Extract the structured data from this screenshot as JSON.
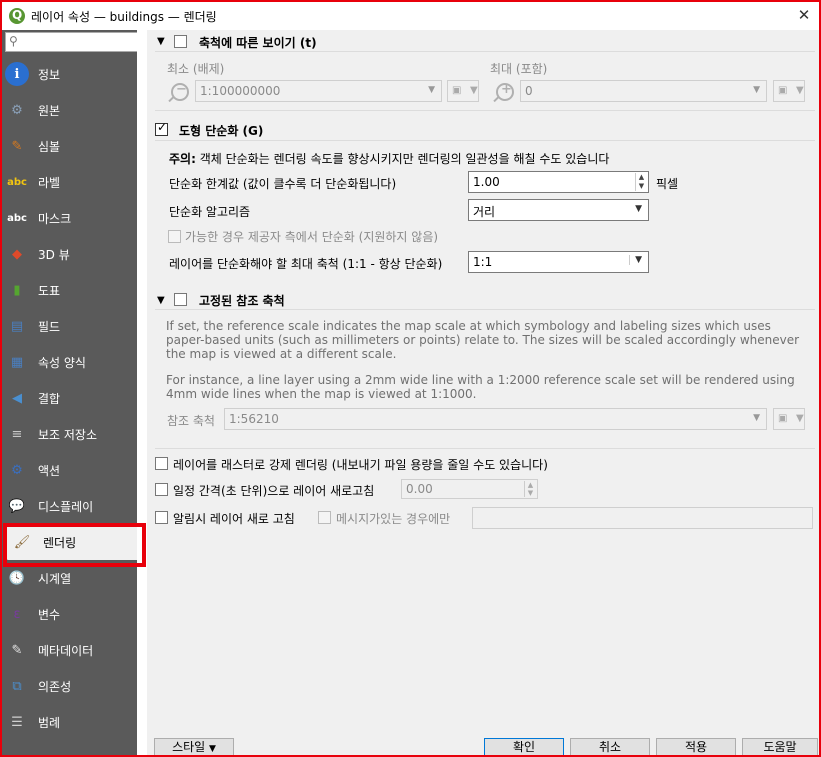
{
  "window": {
    "title": "레이어 속성 — buildings — 렌더링",
    "close_glyph": "✕"
  },
  "sidebar": {
    "search_placeholder": "",
    "items": [
      {
        "label": "정보",
        "icon": "info-icon",
        "color": "#2a6fd0",
        "glyph": "i"
      },
      {
        "label": "원본",
        "icon": "source-icon",
        "color": "#8aa0b8",
        "glyph": "⚙"
      },
      {
        "label": "심볼",
        "icon": "symbology-icon",
        "color": "#d87a1e",
        "glyph": "✎"
      },
      {
        "label": "라벨",
        "icon": "labels-icon",
        "color": "#f2c511",
        "glyph": "abc"
      },
      {
        "label": "마스크",
        "icon": "mask-icon",
        "color": "#ffffff",
        "glyph": "abc"
      },
      {
        "label": "3D 뷰",
        "icon": "3d-view-icon",
        "color": "#e04a2a",
        "glyph": "◆"
      },
      {
        "label": "도표",
        "icon": "diagrams-icon",
        "color": "#55a630",
        "glyph": "▮"
      },
      {
        "label": "필드",
        "icon": "fields-icon",
        "color": "#4a7fc0",
        "glyph": "▤"
      },
      {
        "label": "속성 양식",
        "icon": "attributes-form-icon",
        "color": "#4a7fc0",
        "glyph": "▦"
      },
      {
        "label": "결합",
        "icon": "joins-icon",
        "color": "#4a8fd0",
        "glyph": "◀"
      },
      {
        "label": "보조 저장소",
        "icon": "auxiliary-storage-icon",
        "color": "#c8c8c8",
        "glyph": "≡"
      },
      {
        "label": "액션",
        "icon": "actions-icon",
        "color": "#3a6fc0",
        "glyph": "⚙"
      },
      {
        "label": "디스플레이",
        "icon": "display-icon",
        "color": "#f4d44a",
        "glyph": "💬"
      },
      {
        "label": "렌더링",
        "icon": "rendering-icon",
        "color": "#8a6a3a",
        "glyph": "🖌",
        "active": true
      },
      {
        "label": "시계열",
        "icon": "temporal-icon",
        "color": "#ffffff",
        "glyph": "🕓"
      },
      {
        "label": "변수",
        "icon": "variables-icon",
        "color": "#7a3aa0",
        "glyph": "ε"
      },
      {
        "label": "메타데이터",
        "icon": "metadata-icon",
        "color": "#e0e0e0",
        "glyph": "✎"
      },
      {
        "label": "의존성",
        "icon": "dependencies-icon",
        "color": "#4a8fd0",
        "glyph": "⧉"
      },
      {
        "label": "범례",
        "icon": "legend-icon",
        "color": "#d0d0d0",
        "glyph": "☰"
      }
    ]
  },
  "scale_visibility": {
    "label": "축척에 따른 보이기 (t)",
    "min_label": "최소 (배제)",
    "min_value": "1:100000000",
    "max_label": "최대 (포함)",
    "max_value": "0"
  },
  "simplify": {
    "label": "도형 단순화 (G)",
    "note_prefix": "주의:",
    "note": " 객체 단순화는 렌더링 속도를 향상시키지만 렌더링의 일관성을 해칠 수도 있습니다",
    "threshold_label": "단순화 한계값 (값이 클수록 더 단순화됩니다)",
    "threshold_value": "1.00",
    "threshold_unit": "픽셀",
    "algorithm_label": "단순화 알고리즘",
    "algorithm_value": "거리",
    "provider_label": "가능한 경우 제공자 측에서 단순화 (지원하지 않음)",
    "max_scale_label": "레이어를 단순화해야 할 최대 축척 (1:1 - 항상 단순화)",
    "max_scale_value": "1:1"
  },
  "reference_scale": {
    "label": "고정된 참조 축척",
    "info1": "If set, the reference scale indicates the map scale at which symbology and labeling sizes which uses paper-based units (such as millimeters or points) relate to. The sizes will be scaled accordingly whenever the map is viewed at a different scale.",
    "info2": "For instance, a line layer using a 2mm wide line with a 1:2000 reference scale set will be rendered using 4mm wide lines when the map is viewed at 1:1000.",
    "ref_label": "참조 축척",
    "ref_value": "1:56210"
  },
  "options": {
    "raster_label": "레이어를 래스터로 강제 렌더링 (내보내기 파일 용량을 줄일 수도 있습니다)",
    "refresh_label": "일정 간격(초 단위)으로 레이어 새로고침",
    "refresh_value": "0.00",
    "notify_label": "알림시 레이어 새로 고침",
    "message_label": "메시지가있는 경우에만",
    "message_value": ""
  },
  "footer": {
    "style_label": "스타일",
    "ok_label": "확인",
    "cancel_label": "취소",
    "apply_label": "적용",
    "help_label": "도움말"
  }
}
